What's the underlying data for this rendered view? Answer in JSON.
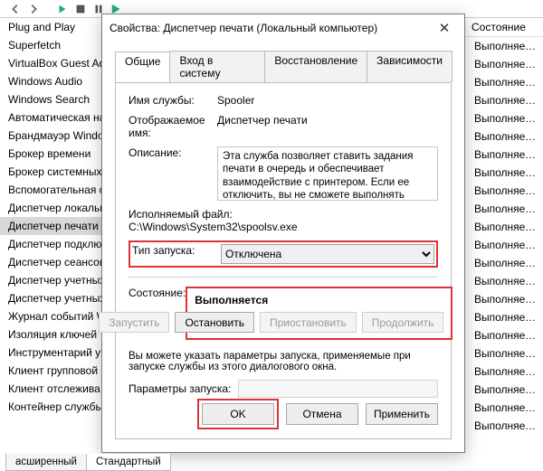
{
  "columns": {
    "state_header": "Состояние"
  },
  "services_left": [
    "Plug and Play",
    "Superfetch",
    "VirtualBox Guest Ad",
    "Windows Audio",
    "Windows Search",
    "Автоматическая на",
    "Брандмауэр Windo",
    "Брокер времени",
    "Брокер системных",
    "Вспомогательная с",
    "Диспетчер локальн",
    "Диспетчер печати",
    "Диспетчер подклю",
    "Диспетчер сеансов",
    "Диспетчер учетных",
    "Диспетчер учетных",
    "Журнал событий W",
    "Изоляция ключей",
    "Инструментарий уп",
    "Клиент групповой",
    "Клиент отслежива",
    "Контейнер службы"
  ],
  "services_right_state": [
    "Выполняется",
    "Выполняется",
    "Выполняется",
    "Выполняется",
    "Выполняется",
    "Выполняется",
    "Выполняется",
    "Выполняется",
    "Выполняется",
    "Выполняется",
    "Выполняется",
    "Выполняется",
    "Выполняется",
    "Выполняется",
    "Выполняется",
    "Выполняется",
    "Выполняется",
    "Выполняется",
    "Выполняется",
    "Выполняется",
    "Выполняется",
    "Выполняется"
  ],
  "selected_service_index": 11,
  "dialog": {
    "title": "Свойства: Диспетчер печати (Локальный компьютер)",
    "tabs": [
      "Общие",
      "Вход в систему",
      "Восстановление",
      "Зависимости"
    ],
    "active_tab": 0,
    "labels": {
      "service_name": "Имя службы:",
      "display_name": "Отображаемое имя:",
      "description": "Описание:",
      "exe_path": "Исполняемый файл:",
      "startup_type": "Тип запуска:",
      "state": "Состояние:",
      "params": "Параметры запуска:"
    },
    "values": {
      "service_name": "Spooler",
      "display_name": "Диспетчер печати",
      "description": "Эта служба позволяет ставить задания печати в очередь и обеспечивает взаимодействие с принтером. Если ее отключить, вы не сможете выполнять печать и видеть свои принтеры.",
      "exe_path": "C:\\Windows\\System32\\spoolsv.exe",
      "startup_type": "Отключена",
      "state": "Выполняется",
      "params": ""
    },
    "note": "Вы можете указать параметры запуска, применяемые при запуске службы из этого диалогового окна.",
    "buttons": {
      "start": "Запустить",
      "stop": "Остановить",
      "pause": "Приостановить",
      "resume": "Продолжить",
      "ok": "OK",
      "cancel": "Отмена",
      "apply": "Применить"
    }
  },
  "bottom_tabs": {
    "extended": "асширенный",
    "standard": "Стандартный"
  }
}
